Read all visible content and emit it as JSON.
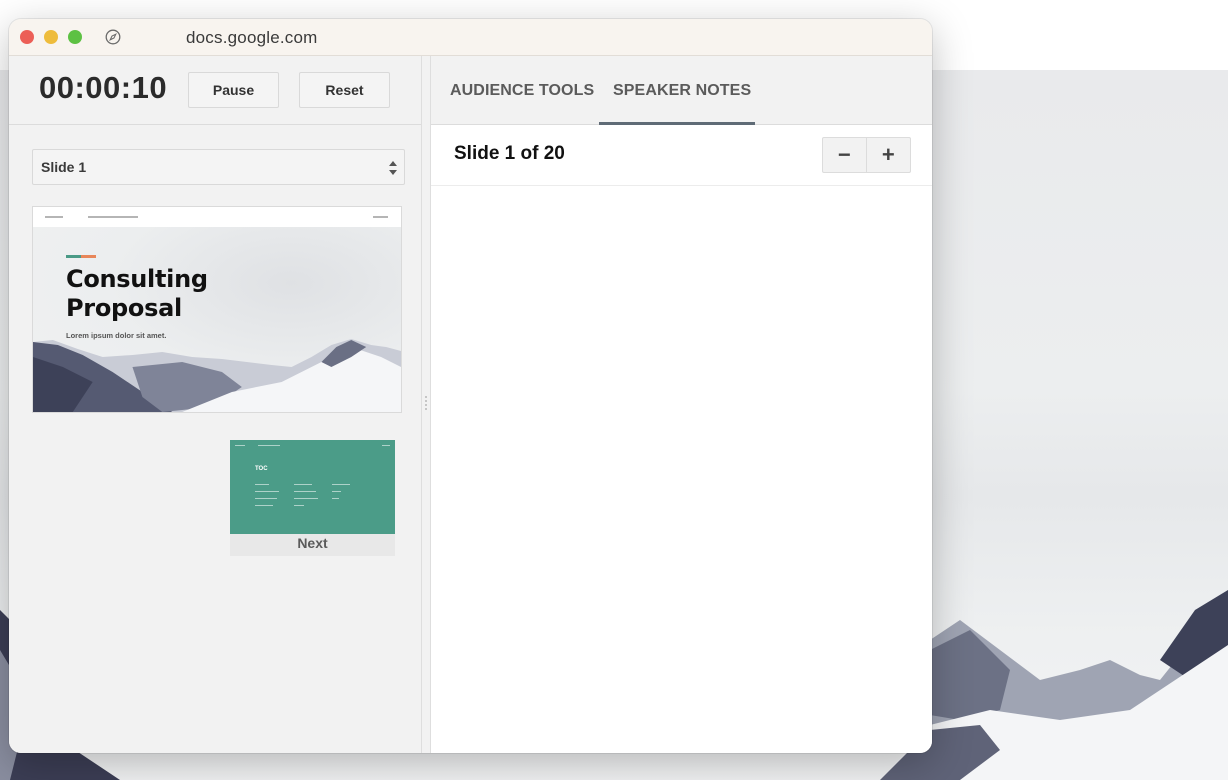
{
  "browser": {
    "url": "docs.google.com",
    "icons": {
      "close": "close-window-icon",
      "minimize": "minimize-window-icon",
      "maximize": "maximize-window-icon",
      "compass": "compass-icon"
    }
  },
  "timer": {
    "elapsed": "00:00:10",
    "pause_label": "Pause",
    "reset_label": "Reset"
  },
  "slide_selector": {
    "selected": "Slide 1",
    "icon": "updown-arrows-icon"
  },
  "current_slide": {
    "title_line1": "Consulting",
    "title_line2": "Proposal",
    "subtitle": "Lorem ipsum dolor sit amet.",
    "accent_colors": [
      "#4a9a86",
      "#e8865a"
    ]
  },
  "next_slide": {
    "heading": "TOC",
    "label": "Next",
    "background_color": "#4b9c88"
  },
  "tabs": [
    {
      "label": "AUDIENCE TOOLS",
      "active": false
    },
    {
      "label": "SPEAKER NOTES",
      "active": true
    }
  ],
  "notes": {
    "slide_position": "Slide 1 of 20",
    "zoom_out_label": "−",
    "zoom_in_label": "+"
  },
  "colors": {
    "tab_underline": "#5f6b76"
  }
}
